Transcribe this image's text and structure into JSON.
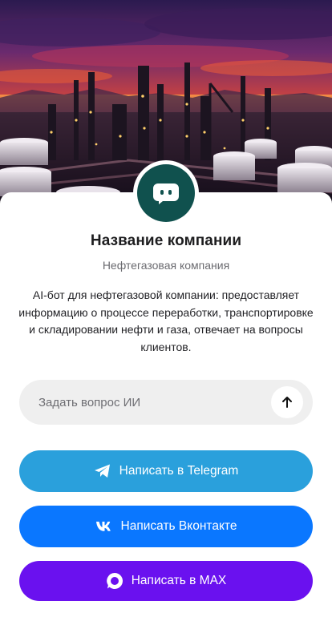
{
  "profile": {
    "name": "Название компании",
    "type": "Нефтегазовая компания",
    "description": "AI-бот для нефтегазовой компании: предоставляет информацию о процессе переработки, транспортировке и складировании нефти и газа, отвечает на вопросы клиентов."
  },
  "ask": {
    "placeholder": "Задать вопрос ИИ",
    "value": ""
  },
  "buttons": {
    "telegram": "Написать в Telegram",
    "vk": "Написать Вконтакте",
    "max": "Написать в MAX"
  },
  "colors": {
    "avatar": "#10514e",
    "telegram": "#2aa0dc",
    "vk": "#0a77ff",
    "max": "#6a11ef",
    "ask_field": "#efefef"
  },
  "icons": {
    "avatar": "chat-bot-icon",
    "send": "arrow-up-icon",
    "telegram": "telegram-icon",
    "vk": "vk-icon",
    "max": "max-icon"
  }
}
